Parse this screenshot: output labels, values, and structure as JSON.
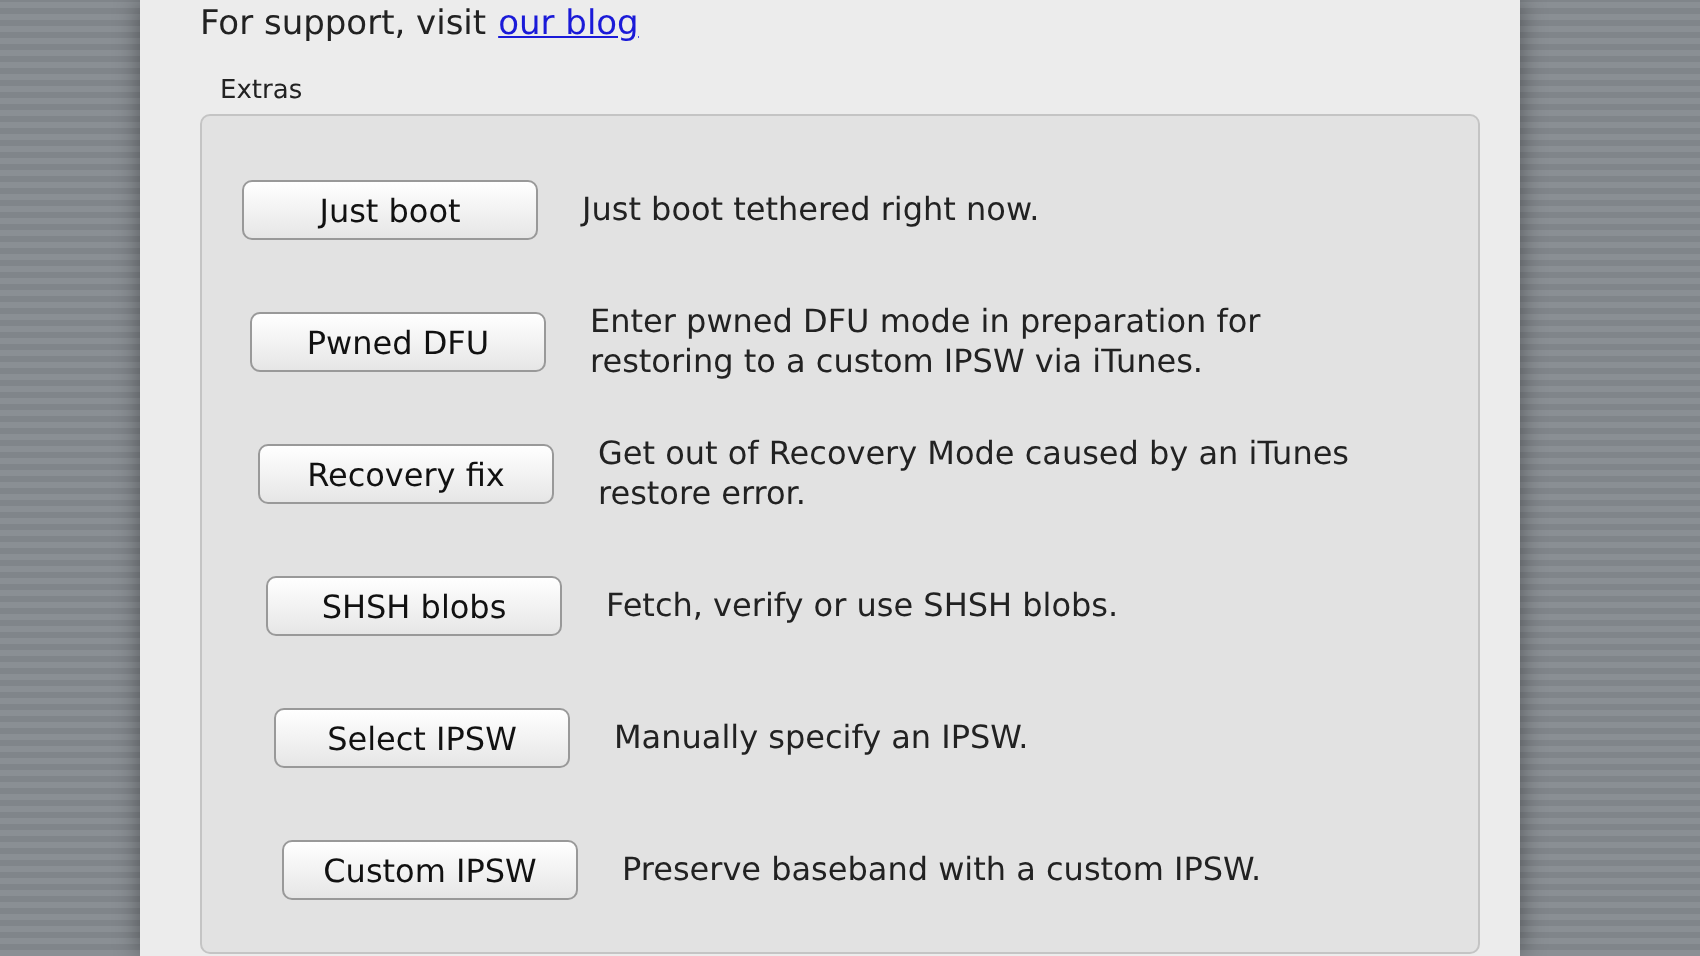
{
  "support": {
    "text": "For support, visit",
    "link": "our blog"
  },
  "group": {
    "title": "Extras",
    "items": [
      {
        "button": "Just boot",
        "description": "Just boot tethered right now."
      },
      {
        "button": "Pwned DFU",
        "description": "Enter pwned DFU mode in preparation for restoring to a custom IPSW via iTunes."
      },
      {
        "button": "Recovery fix",
        "description": "Get out of Recovery Mode caused by an iTunes restore error."
      },
      {
        "button": "SHSH blobs",
        "description": "Fetch, verify or use SHSH blobs."
      },
      {
        "button": "Select IPSW",
        "description": "Manually specify an IPSW."
      },
      {
        "button": "Custom IPSW",
        "description": "Preserve baseband with a custom IPSW."
      }
    ]
  }
}
